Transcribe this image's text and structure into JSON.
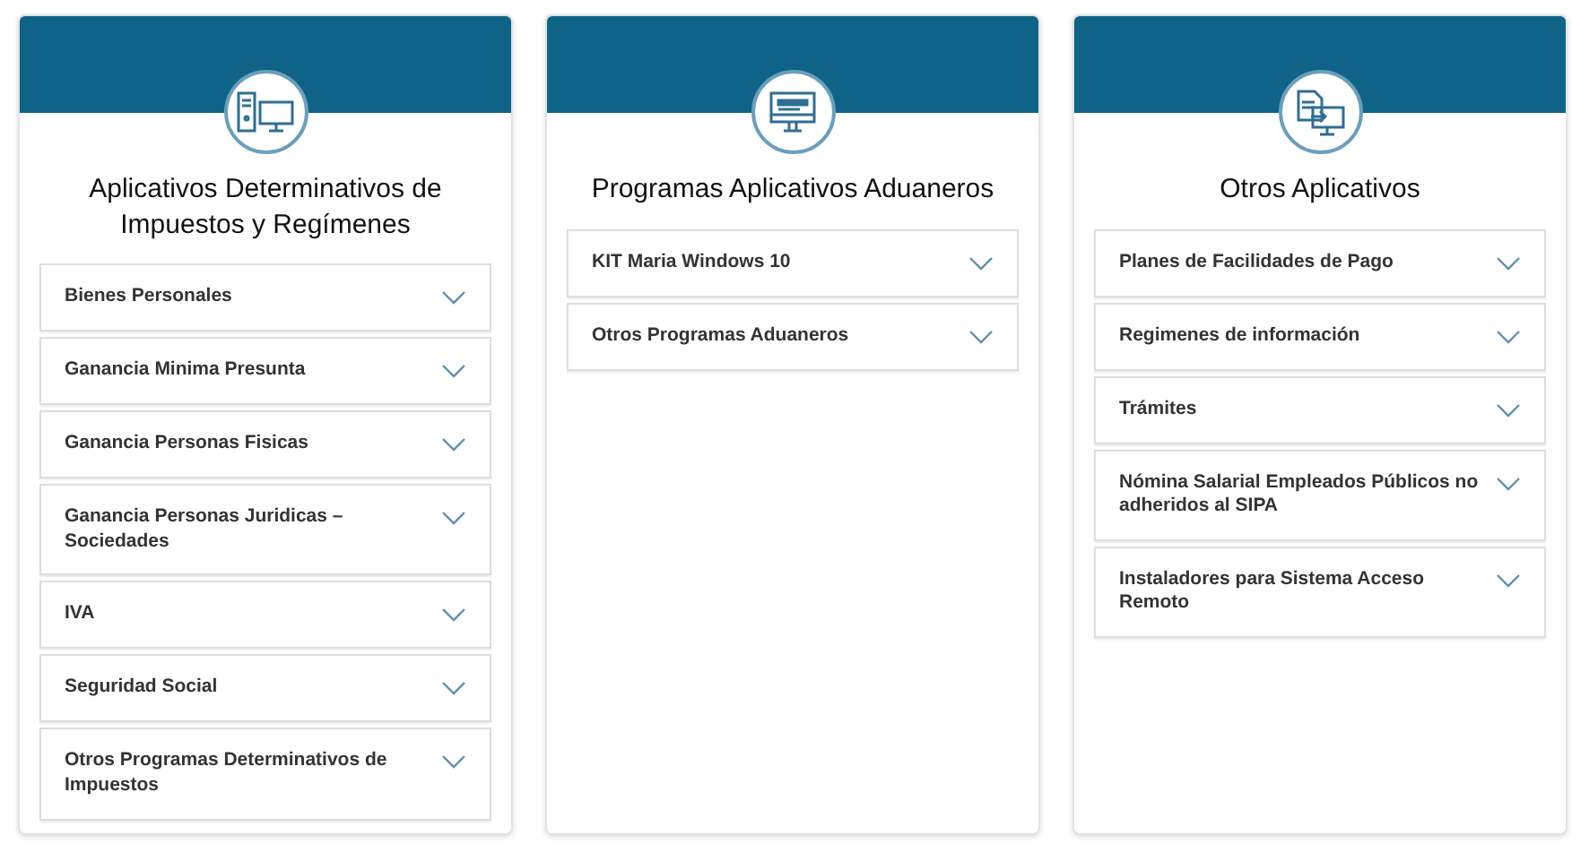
{
  "cards": [
    {
      "kind": "computer",
      "title": "Aplicativos Determinativos de Impuestos y Regímenes",
      "items": [
        {
          "label": "Bienes Personales",
          "expanded": false
        },
        {
          "label": "Ganancia Minima Presunta",
          "expanded": false
        },
        {
          "label": "Ganancia Personas Fisicas",
          "expanded": false
        },
        {
          "label": "Ganancia Personas Juridicas – Sociedades",
          "expanded": false
        },
        {
          "label": "IVA",
          "expanded": false
        },
        {
          "label": "Seguridad Social",
          "expanded": false
        },
        {
          "label": "Otros Programas Determinativos de Impuestos",
          "expanded": false
        }
      ]
    },
    {
      "kind": "monitor",
      "title": "Programas Aplicativos Aduaneros",
      "items": [
        {
          "label": "KIT Maria Windows 10",
          "expanded": false
        },
        {
          "label": "Otros Programas Aduaneros",
          "expanded": false
        }
      ]
    },
    {
      "kind": "transfer",
      "title": "Otros Aplicativos",
      "items": [
        {
          "label": "Planes de Facilidades de Pago",
          "expanded": false
        },
        {
          "label": "Regimenes de información",
          "expanded": false
        },
        {
          "label": "Trámites",
          "expanded": false
        },
        {
          "label": "Nómina Salarial Empleados Públicos no adheridos al SIPA",
          "expanded": false
        },
        {
          "label": "Instaladores para Sistema Acceso Remoto",
          "expanded": false
        }
      ]
    }
  ]
}
